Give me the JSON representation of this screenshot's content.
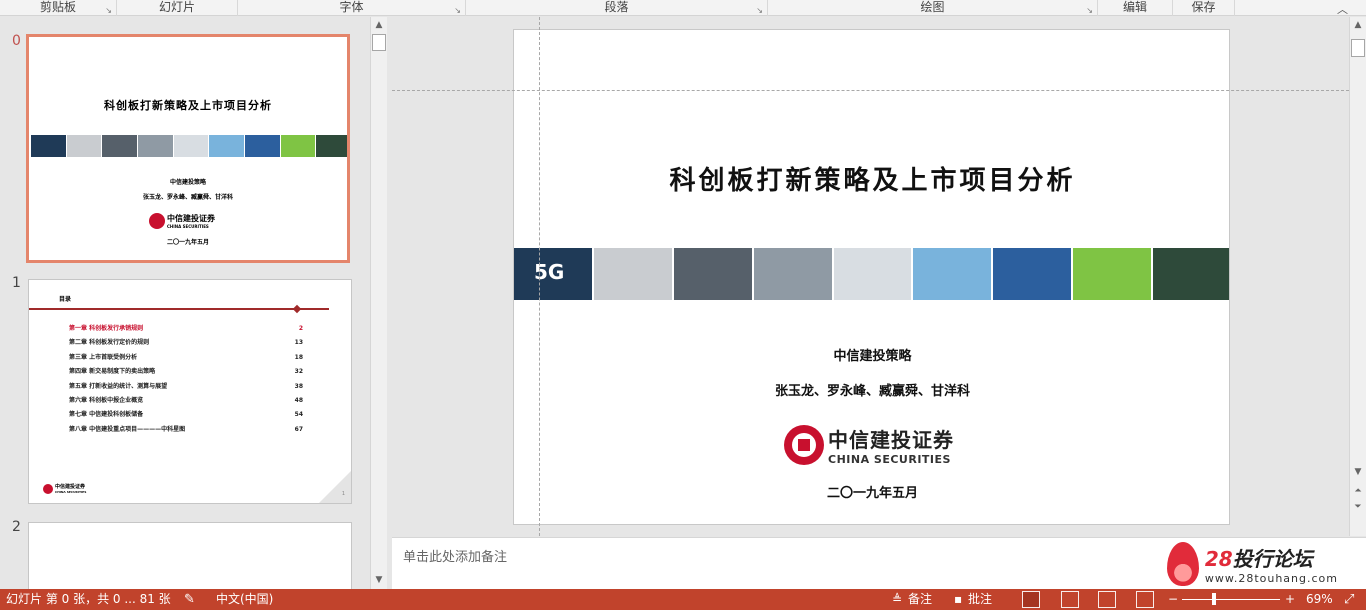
{
  "ribbon": {
    "groups": [
      {
        "label": "剪贴板",
        "launcher": "↘"
      },
      {
        "label": "幻灯片",
        "launcher": ""
      },
      {
        "label": "字体",
        "launcher": "↘"
      },
      {
        "label": "段落",
        "launcher": "↘"
      },
      {
        "label": "绘图",
        "launcher": "↘"
      },
      {
        "label": "编辑",
        "launcher": ""
      },
      {
        "label": "保存",
        "launcher": ""
      }
    ],
    "collapse_icon": "chevron-up-icon"
  },
  "thumbnails": [
    {
      "number": "0",
      "title": "科创板打新策略及上市项目分析",
      "subtitle1": "中信建投策略",
      "subtitle2": "张玉龙、罗永峰、臧赢舜、甘洋科",
      "logo_cn": "中信建投证券",
      "logo_en": "CHINA SECURITIES",
      "date": "二〇一九年五月"
    },
    {
      "number": "1",
      "toc_title": "目录",
      "toc": [
        {
          "label": "第一章  科创板发行承销规则",
          "page": "2",
          "highlight": true
        },
        {
          "label": "第二章  科创板发行定价的规则",
          "page": "13",
          "highlight": false
        },
        {
          "label": "第三章  上市首联受例分析",
          "page": "18",
          "highlight": false
        },
        {
          "label": "第四章  新交易制度下的卖出策略",
          "page": "32",
          "highlight": false
        },
        {
          "label": "第五章  打新收益的统计、测算与展望",
          "page": "38",
          "highlight": false
        },
        {
          "label": "第六章  科创板中报企业概览",
          "page": "48",
          "highlight": false
        },
        {
          "label": "第七章  中信建投科创板储备",
          "page": "54",
          "highlight": false
        },
        {
          "label": "第八章  中信建投重点项目————中科星图",
          "page": "67",
          "highlight": false
        }
      ],
      "logo_cn": "中信建投证券",
      "logo_en": "CHINA SECURITIES",
      "page_mark": "1"
    },
    {
      "number": "2"
    }
  ],
  "slide": {
    "title": "科创板打新策略及上市项目分析",
    "strip_label": "5G",
    "strip_colors": [
      "#1f3a57",
      "#c9ccd0",
      "#56606a",
      "#8f9aa4",
      "#d8dde2",
      "#79b3dc",
      "#2c5f9e",
      "#7fc444",
      "#2e4a3a"
    ],
    "subtitle1": "中信建投策略",
    "subtitle2": "张玉龙、罗永峰、臧赢舜、甘洋科",
    "logo_cn": "中信建投证券",
    "logo_en": "CHINA SECURITIES",
    "date": "二〇一九年五月"
  },
  "notes": {
    "placeholder": "单击此处添加备注"
  },
  "watermark": {
    "cn_num": "28",
    "cn_text": "投行论坛",
    "url": "www.28touhang.com"
  },
  "status": {
    "slide_info": "幻灯片 第 0 张，共 0 ... 81 张",
    "language": "中文(中国)",
    "notes_label": "备注",
    "comments_label": "批注",
    "zoom": "69%",
    "zoom_out": "−",
    "zoom_in": "+",
    "accent": "#c1432c"
  }
}
